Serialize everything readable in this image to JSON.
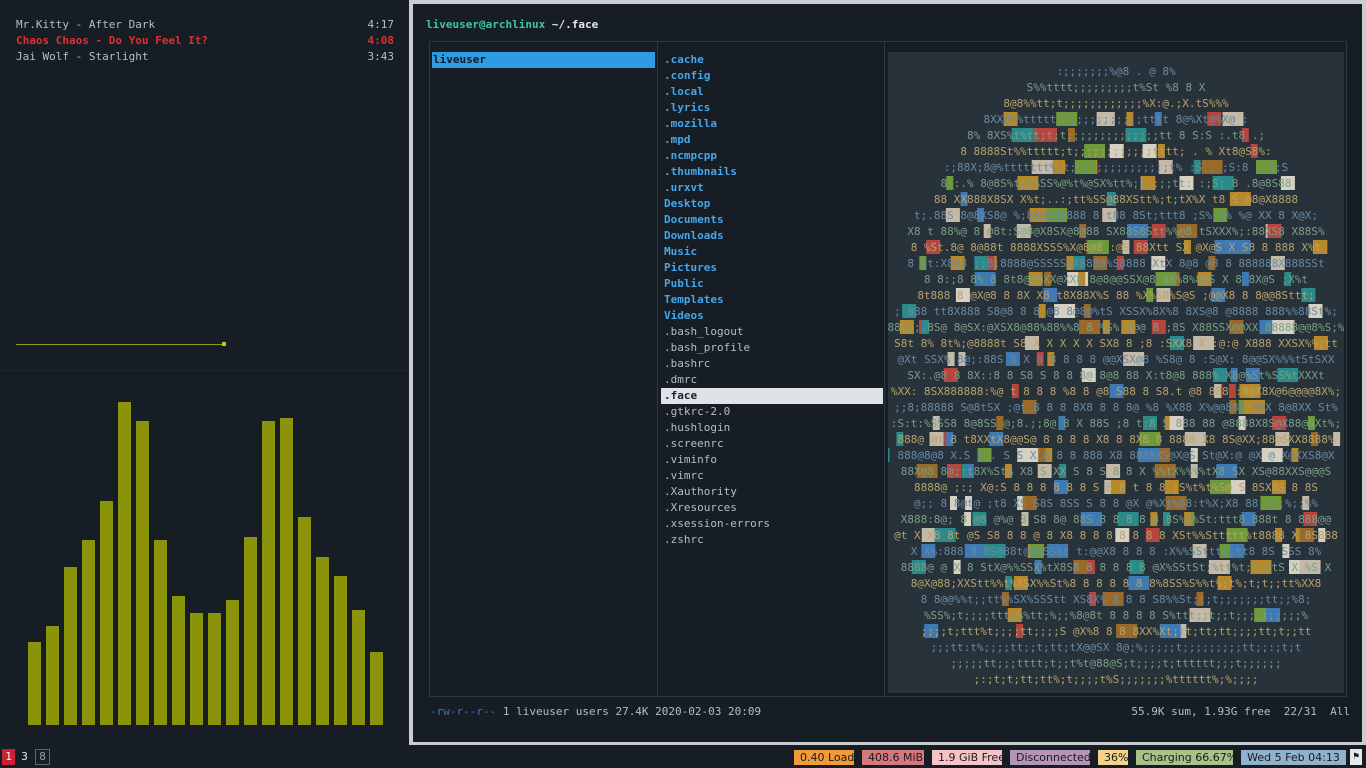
{
  "player": {
    "playlist": [
      {
        "title": "Mr.Kitty - After Dark",
        "duration": "4:17",
        "playing": false
      },
      {
        "title": "Chaos Chaos - Do You Feel It?",
        "duration": "4:08",
        "playing": true
      },
      {
        "title": "Jai Wolf - Starlight",
        "duration": "3:43",
        "playing": false
      }
    ],
    "visualizer_levels": [
      0.25,
      0.3,
      0.48,
      0.56,
      0.68,
      0.98,
      0.92,
      0.56,
      0.39,
      0.34,
      0.34,
      0.38,
      0.57,
      0.92,
      0.93,
      0.63,
      0.51,
      0.45,
      0.35,
      0.22
    ],
    "bar_color": "#8a9309"
  },
  "ranger": {
    "title_user": "liveuser@archlinux",
    "title_path": "~/.face",
    "parent_entry": "liveuser",
    "entries": [
      {
        "name": ".cache",
        "dir": true
      },
      {
        "name": ".config",
        "dir": true
      },
      {
        "name": ".local",
        "dir": true
      },
      {
        "name": ".lyrics",
        "dir": true
      },
      {
        "name": ".mozilla",
        "dir": true
      },
      {
        "name": ".mpd",
        "dir": true
      },
      {
        "name": ".ncmpcpp",
        "dir": true
      },
      {
        "name": ".thumbnails",
        "dir": true
      },
      {
        "name": ".urxvt",
        "dir": true
      },
      {
        "name": "Desktop",
        "dir": true
      },
      {
        "name": "Documents",
        "dir": true
      },
      {
        "name": "Downloads",
        "dir": true
      },
      {
        "name": "Music",
        "dir": true
      },
      {
        "name": "Pictures",
        "dir": true
      },
      {
        "name": "Public",
        "dir": true
      },
      {
        "name": "Templates",
        "dir": true
      },
      {
        "name": "Videos",
        "dir": true
      },
      {
        "name": ".bash_logout",
        "dir": false
      },
      {
        "name": ".bash_profile",
        "dir": false
      },
      {
        "name": ".bashrc",
        "dir": false
      },
      {
        "name": ".dmrc",
        "dir": false
      },
      {
        "name": ".face",
        "dir": false,
        "selected": true
      },
      {
        "name": ".gtkrc-2.0",
        "dir": false
      },
      {
        "name": ".hushlogin",
        "dir": false
      },
      {
        "name": ".screenrc",
        "dir": false
      },
      {
        "name": ".viminfo",
        "dir": false
      },
      {
        "name": ".vimrc",
        "dir": false
      },
      {
        "name": ".Xauthority",
        "dir": false
      },
      {
        "name": ".Xresources",
        "dir": false
      },
      {
        "name": ".xsession-errors",
        "dir": false
      },
      {
        "name": ".zshrc",
        "dir": false
      }
    ],
    "status": {
      "permissions": "-rw-r--r--",
      "info": "1 liveuser users 27.4K 2020-02-03 20:09",
      "summary": "55.9K sum, 1.93G free",
      "position": "22/31",
      "scroll": "All"
    },
    "preview": {
      "description_icon": "ascii-art-preview",
      "lines": [
        ":;;;;;;;%@8 . @ 8%",
        "S%%tttt;;;;;;;;;t%St  %8  8 X",
        "8@8%%tt;t;;;;;;;;;;;;%X:@.;X.tS%%%",
        "8XX8%%ttttt;t;;;;;;;;;;;tttt 8@%Xt@%X@ :",
        "8% 8XS%t%tt;t;t;;;;;;;;;;;;;;tt 8 S:S :.t8 .;",
        "8 8888St%%ttttt;t;;;;;;;;;;;;tttt;  . % Xt8@S8%:",
        ":;88X;8@%ttttttt%tt;t;;;;;;;;;;;;;t%  :S...;S:8 ; X;S",
        "8 :.% 8@8S%tSS%SS%@%t%@SX%tt%;;;;;;tt: :;S;  8 .8@8S88",
        "88 XX888X8SX X%t;..:;tt%SS@88XStt%;t;tX%X t8 S  @8@X8888",
        "t;.88S 8@8XS8@ %;8888@8888 8 t88  8St;ttt8 ;S%;%% %@ XX 8 X@X;",
        "X8 t 88%@ 8 @8t:S@8@X8SX@8@88 SX88S8Stt%%@8 tSXXX%;:88XS8 X88S%",
        "8 %St.8@ 8@88t  8888XSSS%X@8@8 :@S  88Xtt SX @X@S X S8 8 888 X%t",
        "8 8t:X888 ;;8:8888@SSSSS%X8888%S8888 XtX 8@8 @8 8 888888X888SSt",
        "8 8:;8 8% 8 8t8@@@XX@XX8 8@8@@SSX@8 8X%8%8@S X 8 8X@S ;X%t",
        "8t888 8 @X@8   8  8X X8 t8X88X%S  88 %X%S8%S@S ;@@X8 8 8@@8Sttt;",
        ";  888 tt8X888 S8@8 8  8 @8 8@8@%tS XSSX%8X%8  8XS@8   @8888 888%%88St%;",
        "SX88X:;.8S@ 8@SX:@XSX8@88%88%%8 8 %S% 8@@ 8 ;8S X88SSX@@XX 88888@@8%S;%;t",
        "S8t 8% 8t%;@8888t  S8 X X  X X X SX8 8 ;8 :SXX8 X :@:@  X888 XXSX%%;tt",
        "@Xt SSX% 8@;:88S 8 X 8 8 8 8 8 @@XSX@8 %S8@ 8 :S@X:  8@@SX%%%tStSXX",
        "SX:.@8  8 8X::8 8  S8 S 8 8 8@ 8@8 88  X:t8@8 888% X8@%St%SS%tXXXt",
        "%XX: 8SX888888:%@ t 8 8 8  %8 8 @8 S88  8  S8.t @8 888 :8@X8X@6@@@@8X%;",
        ";;8;88888  S@8tSX ;@t 8 8 8 8X8 8 8 8@  %8 %X88 X%@@888 X@X 8@8XX St%",
        ":S:t:%SSS8 8@8SS @;8.;;8@ 8 X 88S ;8 t:8 S 888 88 @8888X8S@X88@8Xt%;",
        "888@ @t 8  t8XXtX8@@S@ 8  8  8 8 X8 8 8X8 8 8888 X8 8S@XX;88@SXX8888%",
        "888@8@8 X.S 8 .  S S    X 8 8 8 888 X8 8888XS@X@S St@X:@  @X @ X@XXS8@X",
        "88X@8 8@;:t8X%St% X8 S  XX S 8 S 8 8 X %%tX%%%%tX8 SX XS@88XXS@@@S",
        "8888@ ;:; X@:S 8 8 8 8 8 8 S 8 8 t 8 8 :S%t%t%S@ S 8SX8S 8 8S",
        "@;; 8 8@t@ ;t8 XS S8S 8SS S 8 8 @X @%Xt%88:t%X;X8  88 ;;;%;;%%",
        "X888:8@; 8 @8 @%@ 8  S8 8@ 88S 8 8 8 8 8 8S%t%St:ttt8 888t 8  888@@",
        "@t X X8 8t @S S8 8 8 @ 8 X8 8 8 8 8 8 8 8 XSt%%Sttttt%t8888 X  8S888",
        "X X%:888 8 8S@88t@@XSSSt t:@@X8 8 8 8 :X%%SStttt;tt8 8S SSS 8%",
        "8888@ @ X 8 StX@%%SSX%tX8S8 8 8 8 8 8 @X%SStSt;%tt%t;%;StS X %S X",
        "8@X@88;XXStt%%t%XSX%%St%8 8 8 8 8 8 8%8SS%S%%t%;t%;t;t;;tt%XX8",
        "8 8@@%%t;;tt%%SX%SSStt XS8X% 8 8 8 S8%%St;t;t;;;;;;;tt;;%8;",
        "%SS%;t;;;;tttS%%tt;%;;%8@8t 8 8 8 8 S%ttt;;t;;t;;;;t;;;;;%",
        ";;;;t;ttt%t;;;;tt;;;;S @X%8 8 8 8XX%Xt;tt;tt;tt;;;;tt;t;;tt",
        ";;;tt:t%;;;;tt;;t;tt;tX@@SX 8@;%;;;;;t;;;;;;;;;tt;;:;t;t",
        ";;;;;tt;;;tttt;t;;t%t@88@S;t;;;;t;tttttt;;;t;;;;;;",
        ";:;t;t;tt;tt%;t;;;;t%S;;;;;;;%tttttt%;%;;;;"
      ]
    }
  },
  "bottombar": {
    "workspaces": [
      "1",
      "3",
      "8"
    ],
    "badges": [
      {
        "text": "0.40 Load",
        "color": "#f19a3a"
      },
      {
        "text": "408.6 MiB",
        "color": "#d4787d"
      },
      {
        "text": "1.9 GiB Free",
        "color": "#f6c3c7"
      },
      {
        "text": "Disconnected",
        "color": "#b594b9"
      },
      {
        "text": "36%",
        "color": "#f5d48a"
      },
      {
        "text": "Charging 66.67%",
        "color": "#a7c389"
      },
      {
        "text": "Wed 5 Feb 04:13",
        "color": "#8fb2cf"
      }
    ]
  }
}
